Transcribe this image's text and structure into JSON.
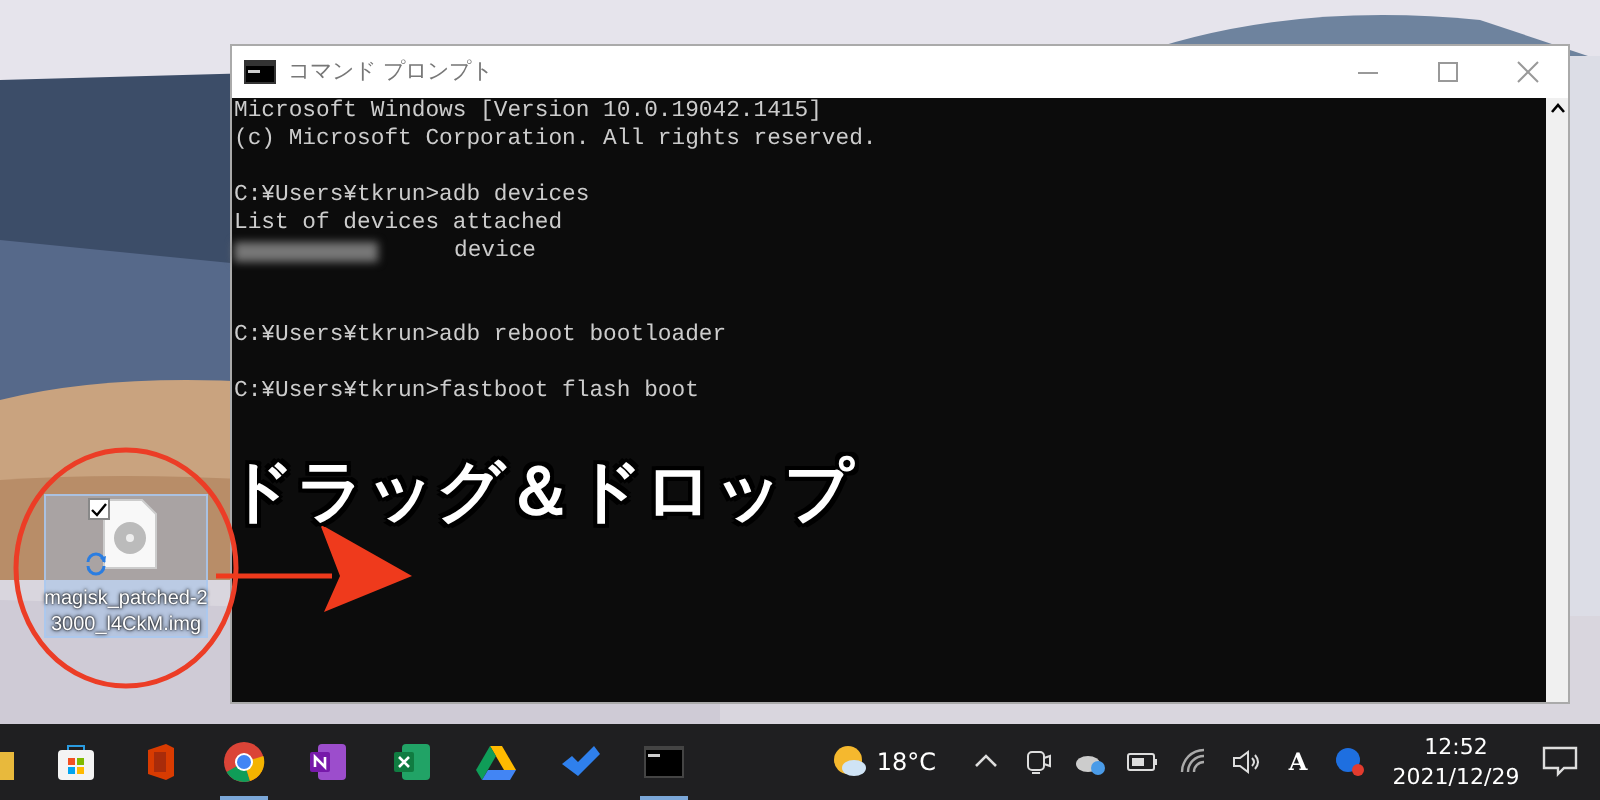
{
  "desktop": {
    "file_icon": {
      "label_lines": [
        "magisk_patched-2",
        "3000_l4CkM.img"
      ],
      "checked": true,
      "selected": true
    }
  },
  "annotation": {
    "caption": "ドラッグ＆ドロップ"
  },
  "window": {
    "title": "コマンド プロンプト",
    "console": [
      {
        "kind": "text",
        "text": "Microsoft Windows [Version 10.0.19042.1415]"
      },
      {
        "kind": "text",
        "text": "(c) Microsoft Corporation. All rights reserved."
      },
      {
        "kind": "blank"
      },
      {
        "kind": "text",
        "text": "C:¥Users¥tkrun>adb devices"
      },
      {
        "kind": "text",
        "text": "List of devices attached"
      },
      {
        "kind": "masked",
        "text": "device"
      },
      {
        "kind": "blank"
      },
      {
        "kind": "blank"
      },
      {
        "kind": "text",
        "text": "C:¥Users¥tkrun>adb reboot bootloader"
      },
      {
        "kind": "blank"
      },
      {
        "kind": "text",
        "text": "C:¥Users¥tkrun>fastboot flash boot"
      }
    ]
  },
  "taskbar": {
    "apps": [
      {
        "kind": "folder",
        "running": false
      },
      {
        "kind": "store",
        "running": false
      },
      {
        "kind": "office",
        "running": false
      },
      {
        "kind": "chrome",
        "running": true
      },
      {
        "kind": "onenote",
        "running": false
      },
      {
        "kind": "excel",
        "running": false
      },
      {
        "kind": "drive",
        "running": false
      },
      {
        "kind": "todo",
        "running": false
      },
      {
        "kind": "terminal",
        "running": true
      }
    ],
    "weather": {
      "temperature": "18°C"
    },
    "tray": [
      {
        "kind": "chevron"
      },
      {
        "kind": "meet"
      },
      {
        "kind": "cloud"
      },
      {
        "kind": "battery"
      },
      {
        "kind": "wifi"
      },
      {
        "kind": "volume"
      }
    ],
    "ime": "A",
    "clock": {
      "time": "12:52",
      "date": "2021/12/29"
    }
  }
}
